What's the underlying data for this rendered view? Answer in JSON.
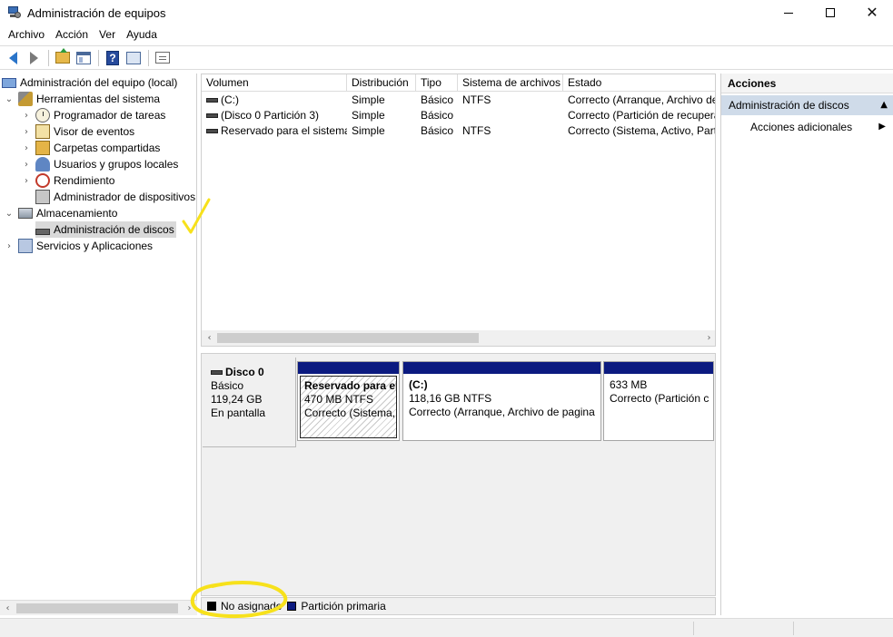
{
  "window": {
    "title": "Administración de equipos",
    "min_label": "",
    "close_label": "✕"
  },
  "menu": [
    "Archivo",
    "Acción",
    "Ver",
    "Ayuda"
  ],
  "tree": {
    "root": "Administración del equipo (local)",
    "system_tools": "Herramientas del sistema",
    "task_scheduler": "Programador de tareas",
    "event_viewer": "Visor de eventos",
    "shared_folders": "Carpetas compartidas",
    "local_users": "Usuarios y grupos locales",
    "performance": "Rendimiento",
    "device_manager": "Administrador de dispositivos",
    "storage": "Almacenamiento",
    "disk_management": "Administración de discos",
    "services": "Servicios y Aplicaciones"
  },
  "volumes": {
    "columns": [
      "Volumen",
      "Distribución",
      "Tipo",
      "Sistema de archivos",
      "Estado"
    ],
    "rows": [
      [
        "(C:)",
        "Simple",
        "Básico",
        "NTFS",
        "Correcto (Arranque, Archivo de"
      ],
      [
        "(Disco 0 Partición 3)",
        "Simple",
        "Básico",
        "",
        "Correcto (Partición de recupera"
      ],
      [
        "Reservado para el sistema",
        "Simple",
        "Básico",
        "NTFS",
        "Correcto (Sistema, Activo, Parti"
      ]
    ]
  },
  "disk": {
    "name": "Disco 0",
    "type": "Básico",
    "size": "119,24 GB",
    "state": "En pantalla",
    "partitions": [
      {
        "name": "Reservado para el",
        "size": "470 MB NTFS",
        "status": "Correcto (Sistema,"
      },
      {
        "name": "(C:)",
        "size": "118,16 GB NTFS",
        "status": "Correcto (Arranque, Archivo de pagina"
      },
      {
        "name": "",
        "size": "633 MB",
        "status": "Correcto (Partición c"
      }
    ]
  },
  "legend": {
    "unallocated": "No asignado",
    "primary": "Partición primaria"
  },
  "actions": {
    "header": "Acciones",
    "section": "Administración de discos",
    "more": "Acciones adicionales"
  },
  "colors": {
    "primary_partition": "#0b1a80",
    "unallocated": "#000000",
    "annotation": "#f7e11b",
    "selection": "#cfdbe9"
  }
}
